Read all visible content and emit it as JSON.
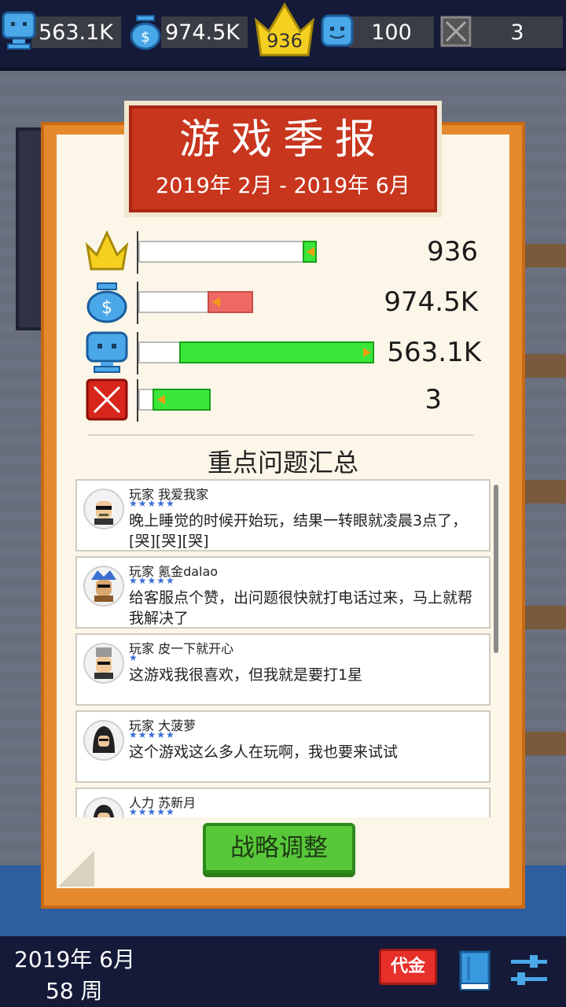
{
  "topbar": {
    "fans": "563.1K",
    "money": "974.5K",
    "crown": "936",
    "players": "100",
    "bugs": "3"
  },
  "report": {
    "title": "游戏季报",
    "period": "2019年 2月 - 2019年 6月",
    "stats": [
      {
        "icon": "crown-icon",
        "value": "936",
        "level": 0.92,
        "change_color": "#3be63b"
      },
      {
        "icon": "money-bag-icon",
        "value": "974.5K",
        "level": 0.33,
        "change_color": "#ef6a64"
      },
      {
        "icon": "player-icon",
        "value": "563.1K",
        "level": 1.0,
        "change_color": "#3be63b"
      },
      {
        "icon": "bug-x-icon",
        "value": "3",
        "level": 0.32,
        "change_color": "#3be63b"
      }
    ],
    "issues_title": "重点问题汇总",
    "comments": [
      {
        "user": "玩家 我爱我家",
        "stars": 5,
        "text": "晚上睡觉的时候开始玩，结果一转眼就凌晨3点了，[哭][哭][哭]"
      },
      {
        "user": "玩家 氪金dalao",
        "stars": 5,
        "text": "给客服点个赞，出问题很快就打电话过来，马上就帮我解决了"
      },
      {
        "user": "玩家 皮一下就开心",
        "stars": 1,
        "text": "这游戏我很喜欢，但我就是要打1星"
      },
      {
        "user": "玩家 大菠萝",
        "stars": 5,
        "text": "这个游戏这么多人在玩啊，我也要来试试"
      },
      {
        "user": "人力 苏新月",
        "stars": 5,
        "text": ""
      }
    ],
    "strategy_button": "战略调整"
  },
  "bottombar": {
    "date": "2019年 6月",
    "week": "58 周",
    "cash_button": "代金"
  }
}
